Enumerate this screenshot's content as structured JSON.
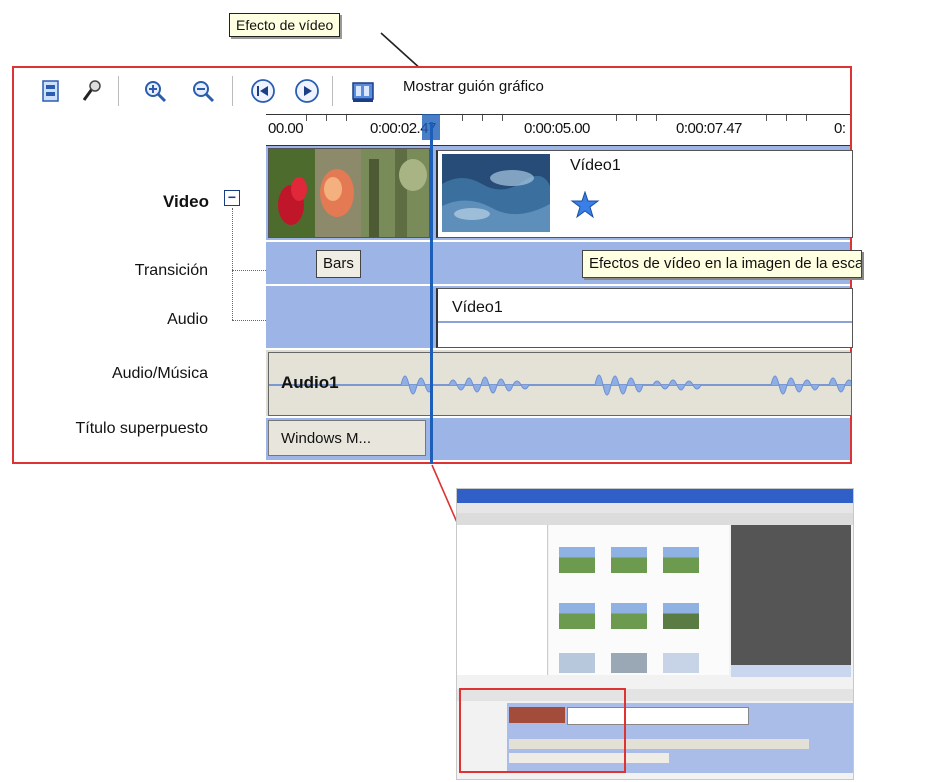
{
  "callout": {
    "text": "Efecto de vídeo"
  },
  "toolbar": {
    "buttons": [
      {
        "name": "storyboard-icon"
      },
      {
        "name": "narrate-mic-icon"
      },
      {
        "name": "zoom-in-icon"
      },
      {
        "name": "zoom-out-icon"
      },
      {
        "name": "rewind-icon"
      },
      {
        "name": "play-icon"
      },
      {
        "name": "film-storyboard-icon"
      }
    ],
    "show_storyboard_label": "Mostrar guión gráfico"
  },
  "ruler": {
    "times": [
      "00.00",
      "0:00:02.47",
      "0:00:05.00",
      "0:00:07.47",
      "0:"
    ]
  },
  "tracks": {
    "video_label": "Video",
    "collapse_symbol": "−",
    "transition_label": "Transición",
    "audio_label": "Audio",
    "audio_music_label": "Audio/Música",
    "title_overlay_label": "Título superpuesto"
  },
  "clips": {
    "video_clip_name": "Vídeo1",
    "transition_name": "Bars",
    "effect_tooltip": "Efectos de vídeo en la imagen de la esca",
    "audio_clip_name": "Vídeo1",
    "music_clip_name": "Audio1",
    "title_clip_name": "Windows M..."
  },
  "colors": {
    "frame_red": "#dd3333",
    "track_blue": "#9db4e6",
    "playhead_blue": "#1d5eb8",
    "tooltip_yellow": "#ffffe1"
  }
}
